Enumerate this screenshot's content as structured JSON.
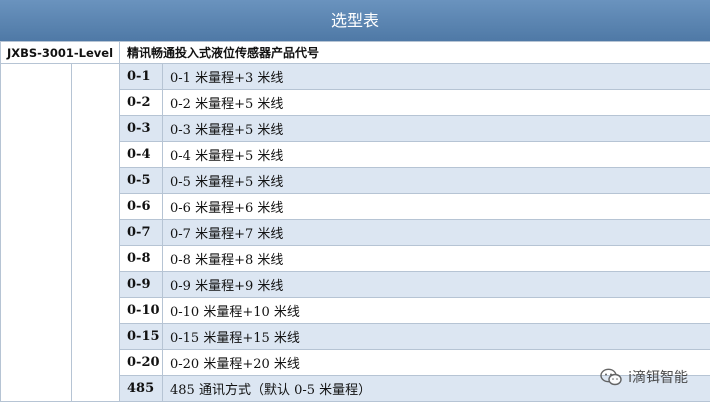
{
  "title": "选型表",
  "header": {
    "model": "JXBS-3001-Level",
    "product": "精讯畅通投入式液位传感器产品代号"
  },
  "rows": [
    {
      "code": "0-1",
      "desc": "0-1 米量程+3 米线"
    },
    {
      "code": "0-2",
      "desc": "0-2 米量程+5 米线"
    },
    {
      "code": "0-3",
      "desc": "0-3 米量程+5 米线"
    },
    {
      "code": "0-4",
      "desc": "0-4 米量程+5 米线"
    },
    {
      "code": "0-5",
      "desc": "0-5 米量程+5 米线"
    },
    {
      "code": "0-6",
      "desc": "0-6 米量程+6 米线"
    },
    {
      "code": "0-7",
      "desc": "0-7 米量程+7 米线"
    },
    {
      "code": "0-8",
      "desc": "0-8 米量程+8 米线"
    },
    {
      "code": "0-9",
      "desc": "0-9 米量程+9 米线"
    },
    {
      "code": "0-10",
      "desc": "0-10 米量程+10 米线"
    },
    {
      "code": "0-15",
      "desc": "0-15 米量程+15 米线"
    },
    {
      "code": "0-20",
      "desc": "0-20 米量程+20 米线"
    },
    {
      "code": "485",
      "desc": "485 通讯方式（默认 0-5 米量程）"
    }
  ],
  "watermark": {
    "icon": "wechat-icon",
    "text": "i滴铒智能"
  },
  "colors": {
    "title_bar": "#5a84b0",
    "stripe": "#dce6f2",
    "border": "#b6c4d4"
  }
}
